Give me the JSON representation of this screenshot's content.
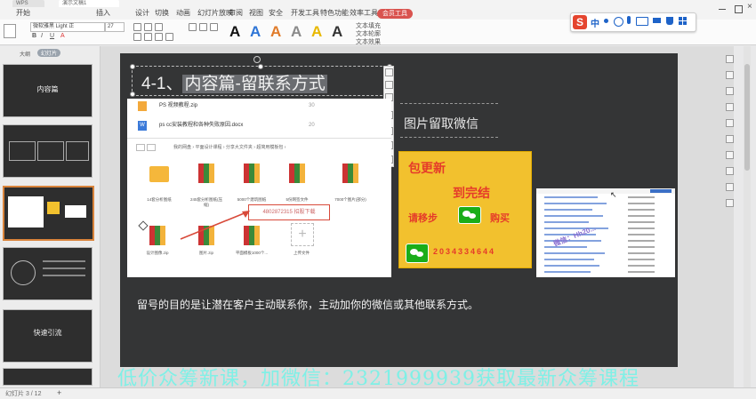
{
  "app": {
    "doc_tabs": [
      "WPS",
      "演示文稿1"
    ],
    "menu_items": [
      "开始",
      "插入",
      "设计",
      "切换",
      "动画",
      "幻灯片放映",
      "审阅",
      "视图",
      "安全",
      "开发工具",
      "特色功能",
      "效率工具"
    ],
    "menu_special": "会员工具",
    "font_name": "微软雅黑 Light 正",
    "font_size": "27",
    "text_tools": [
      "文本填充",
      "文本轮廓",
      "文本效果"
    ],
    "style_letters": [
      "A",
      "A",
      "A",
      "A",
      "A",
      "A"
    ],
    "style_colors": [
      "#111111",
      "#2e75d6",
      "#e07b2a",
      "#8a8a8a",
      "#e8b800",
      "#333333"
    ],
    "ime": {
      "logo": "S",
      "lang": "中"
    }
  },
  "panel": {
    "tabs": [
      "大纲",
      "幻灯片"
    ],
    "thumbs": [
      {
        "num": "",
        "title": "内容篇"
      },
      {
        "num": "",
        "title": ""
      },
      {
        "num": "",
        "title": ""
      },
      {
        "num": "",
        "title": ""
      },
      {
        "num": "",
        "title": "快速引流"
      }
    ]
  },
  "slide": {
    "title_num": "4-1、",
    "title_text": "内容篇-留联系方式",
    "side_label": "图片留取微信",
    "caption": "留号的目的是让潜在客户主动联系你，主动加你的微信或其他联系方式。",
    "file_rows": [
      {
        "name": "PS 视频教程.zip",
        "size": "30"
      },
      {
        "name": "ps cc安装教程和各种失败原因.docx",
        "size": "20"
      }
    ],
    "path": "我的网盘 › 平面设计课程 › 分享大文件夹 › 超简用模板包 ›",
    "folder_items": [
      {
        "label": "14套分析图纸"
      },
      {
        "label": "245套分析图纸(压缩)"
      },
      {
        "label": "5000个建筑图纸"
      },
      {
        "label": "5份网签文件"
      },
      {
        "label": "7000个图片(部分)"
      }
    ],
    "row2_items": [
      {
        "label": "设计图像.zip"
      },
      {
        "label": "图片.zip"
      },
      {
        "label": "平面模板1000个..."
      },
      {
        "label": "上传文件"
      }
    ],
    "hint_text": "4802872315 招股下载",
    "ad": {
      "line1": "包更新",
      "line2": "到完结",
      "line3_a": "请移步",
      "line3_b": "购买",
      "id": "2034334644"
    },
    "list_watermark": "微信：Hh20..."
  },
  "watermark": "低价众筹新课，加微信：2321999939获取最新众筹课程",
  "status": {
    "left": "幻灯片 3 / 12",
    "right": ""
  }
}
